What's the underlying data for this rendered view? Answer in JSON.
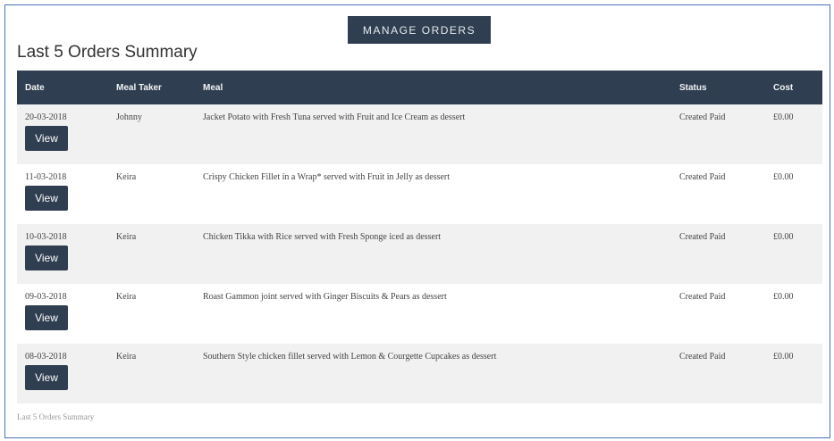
{
  "header": {
    "manage_button": "MANAGE ORDERS"
  },
  "summary": {
    "title": "Last 5 Orders Summary",
    "caption": "Last 5 Orders Summary"
  },
  "table": {
    "columns": [
      "Date",
      "Meal Taker",
      "Meal",
      "Status",
      "Cost"
    ],
    "view_label": "View",
    "rows": [
      {
        "date": "20-03-2018",
        "taker": "Johnny",
        "meal": "Jacket Potato with Fresh Tuna served with Fruit and Ice Cream as dessert",
        "status": "Created Paid",
        "cost": "£0.00"
      },
      {
        "date": "11-03-2018",
        "taker": "Keira",
        "meal": "Crispy Chicken Fillet in a Wrap* served with Fruit in Jelly as dessert",
        "status": "Created Paid",
        "cost": "£0.00"
      },
      {
        "date": "10-03-2018",
        "taker": "Keira",
        "meal": "Chicken Tikka with Rice served with Fresh Sponge iced as dessert",
        "status": "Created Paid",
        "cost": "£0.00"
      },
      {
        "date": "09-03-2018",
        "taker": "Keira",
        "meal": "Roast Gammon joint served with Ginger Biscuits & Pears as dessert",
        "status": "Created Paid",
        "cost": "£0.00"
      },
      {
        "date": "08-03-2018",
        "taker": "Keira",
        "meal": "Southern Style chicken fillet served with Lemon & Courgette Cupcakes as dessert",
        "status": "Created Paid",
        "cost": "£0.00"
      }
    ]
  }
}
